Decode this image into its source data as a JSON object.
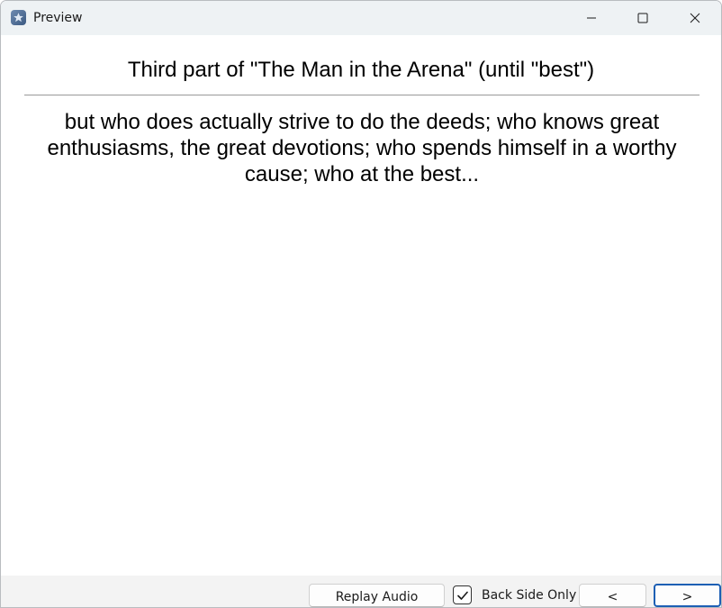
{
  "window": {
    "title": "Preview"
  },
  "card": {
    "front": "Third part of \"The Man in the Arena\" (until \"best\")",
    "back": "but who does actually strive to do the deeds; who knows great enthusiasms, the great devotions; who spends himself in a worthy cause; who at the best..."
  },
  "bottom_bar": {
    "replay_label": "Replay Audio",
    "back_side_only_label": "Back Side Only",
    "back_side_only_checked": true,
    "prev_label": "<",
    "next_label": ">"
  },
  "icons": {
    "app": "anki-app-icon",
    "minimize": "minimize-icon",
    "maximize": "maximize-icon",
    "close": "close-icon",
    "checkmark": "checkmark-icon"
  },
  "colors": {
    "titlebar_bg": "#eef2f4",
    "bottombar_bg": "#f3f3f3",
    "focus_border": "#1d5fb4"
  }
}
